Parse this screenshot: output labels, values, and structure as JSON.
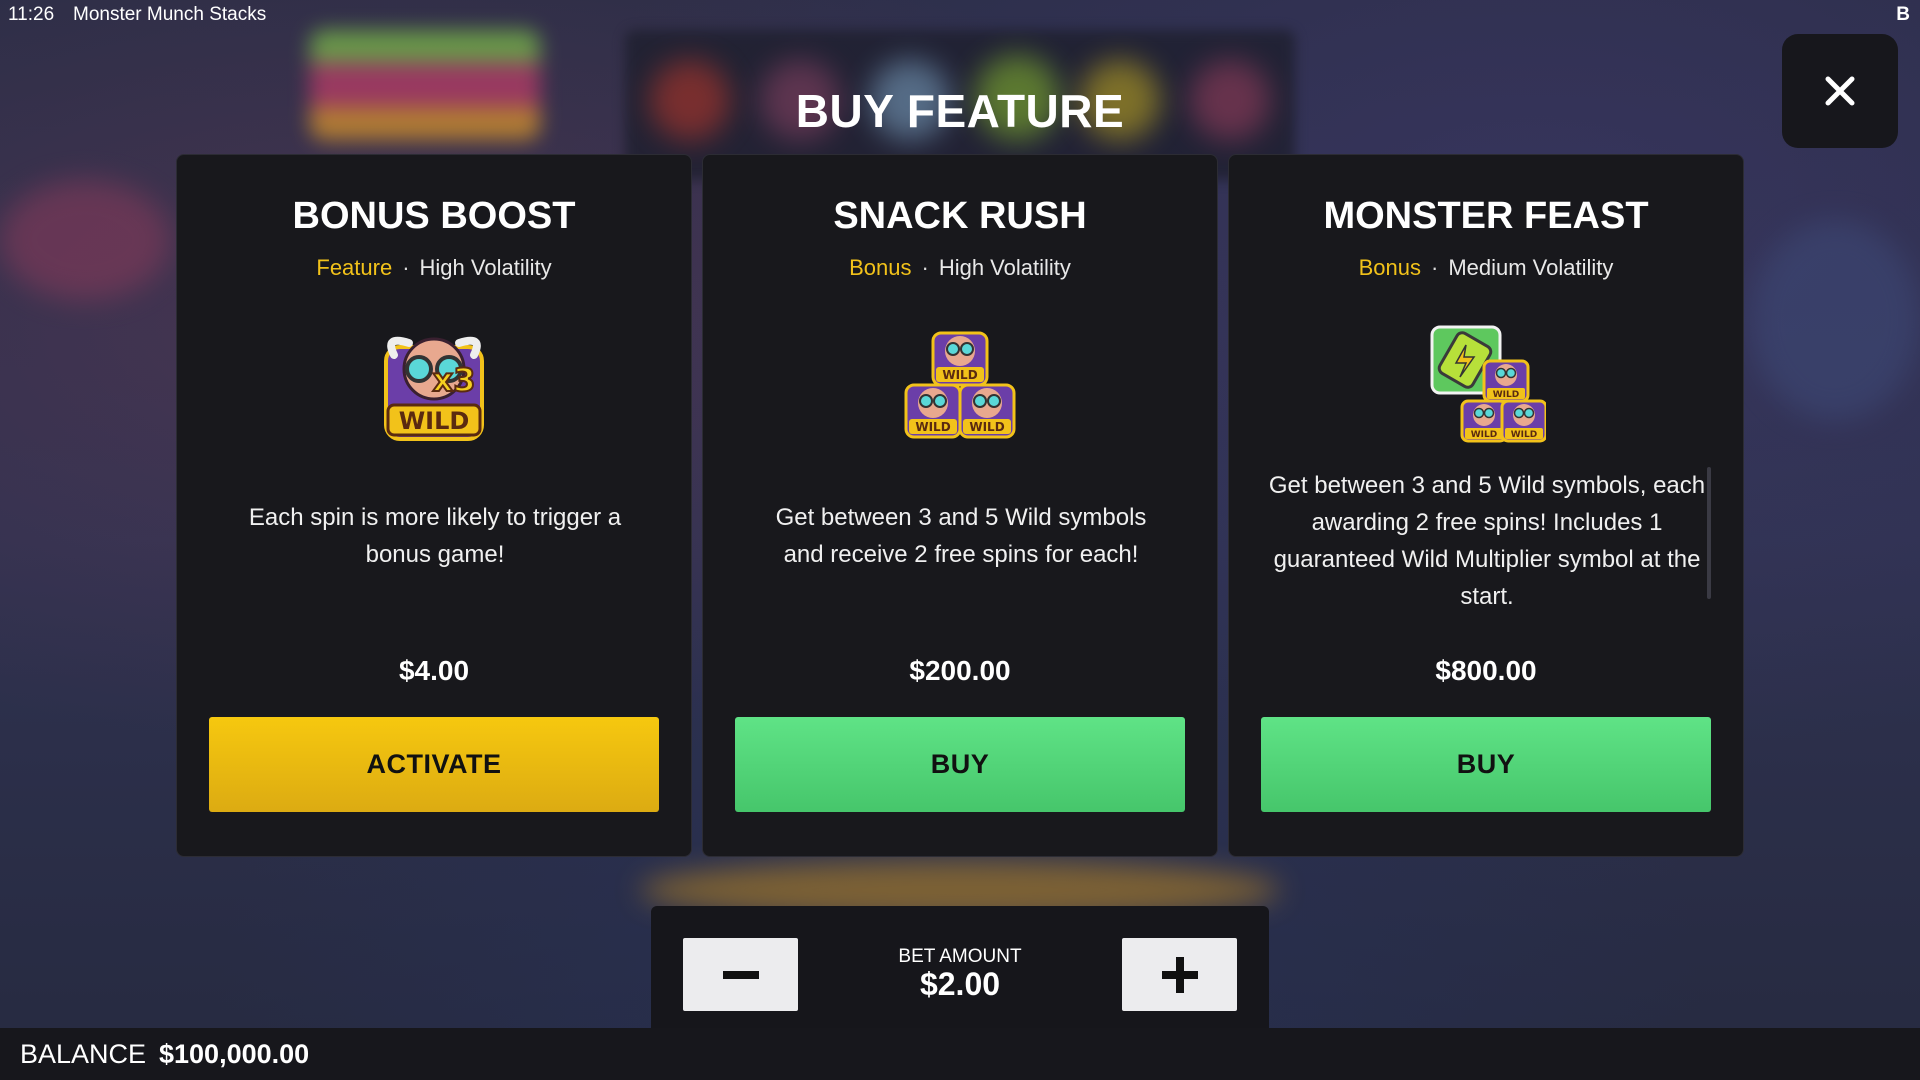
{
  "topbar": {
    "time": "11:26",
    "game_name": "Monster Munch Stacks",
    "corner_label": "B"
  },
  "dialog": {
    "title": "BUY FEATURE"
  },
  "cards": [
    {
      "title": "BONUS BOOST",
      "kind": "Feature",
      "separator": "·",
      "volatility": "High Volatility",
      "icon": "x3-wild-monster-icon",
      "icon_text": "x3",
      "icon_wild_text": "WILD",
      "description": "Each spin is more likely to trigger a bonus game!",
      "price": "$4.00",
      "button_label": "ACTIVATE"
    },
    {
      "title": "SNACK RUSH",
      "kind": "Bonus",
      "separator": "·",
      "volatility": "High Volatility",
      "icon": "three-wild-monsters-icon",
      "icon_wild_text": "WILD",
      "description": "Get between 3 and 5 Wild symbols and receive 2 free spins for each!",
      "price": "$200.00",
      "button_label": "BUY"
    },
    {
      "title": "MONSTER FEAST",
      "kind": "Bonus",
      "separator": "·",
      "volatility": "Medium Volatility",
      "icon": "battery-and-wild-monsters-icon",
      "icon_wild_text": "WILD",
      "description": "Get between 3 and 5 Wild symbols, each awarding 2 free spins! Includes 1 guaranteed Wild Multiplier symbol at the start.",
      "price": "$800.00",
      "button_label": "BUY"
    }
  ],
  "bet": {
    "label": "BET AMOUNT",
    "value": "$2.00",
    "decrease_icon": "minus-icon",
    "increase_icon": "plus-icon"
  },
  "balance": {
    "label": "BALANCE",
    "value": "$100,000.00"
  },
  "colors": {
    "accent_yellow": "#f2c21a",
    "buy_green": "#52d578",
    "card_bg": "#18181c"
  }
}
